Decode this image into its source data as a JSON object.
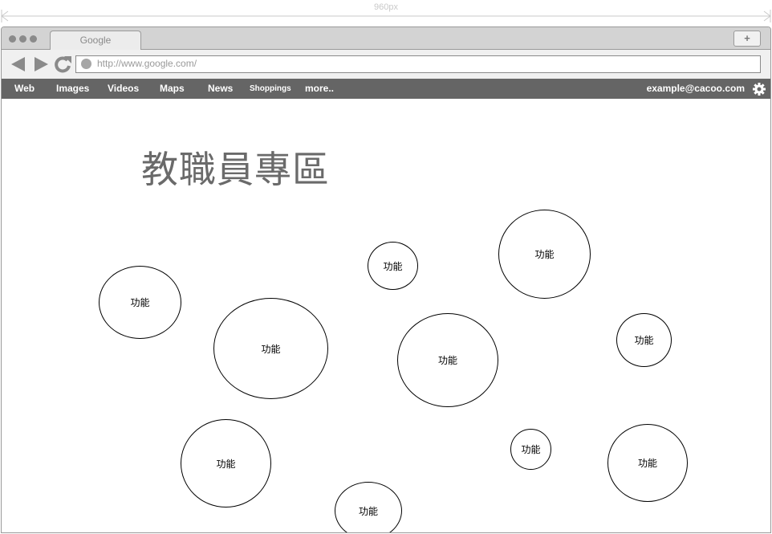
{
  "ruler": {
    "label": "960px"
  },
  "browser": {
    "tab_title": "Google",
    "new_tab_label": "+",
    "url": "http://www.google.com/"
  },
  "navbar": {
    "items": [
      "Web",
      "Images",
      "Videos",
      "Maps",
      "News",
      "Shoppings",
      "more.."
    ],
    "account": "example@cacoo.com"
  },
  "page": {
    "title": "教職員專區",
    "bubbles": [
      {
        "label": "功能"
      },
      {
        "label": "功能"
      },
      {
        "label": "功能"
      },
      {
        "label": "功能"
      },
      {
        "label": "功能"
      },
      {
        "label": "功能"
      },
      {
        "label": "功能"
      },
      {
        "label": "功能"
      },
      {
        "label": "功能"
      },
      {
        "label": "功能"
      }
    ]
  },
  "colors": {
    "navbar_bg": "#656565",
    "titlebar_bg": "#d3d3d3",
    "title_text": "#6a6a6a"
  },
  "icons": [
    "back-arrow-icon",
    "forward-arrow-icon",
    "reload-icon",
    "url-status-icon",
    "gear-icon"
  ]
}
